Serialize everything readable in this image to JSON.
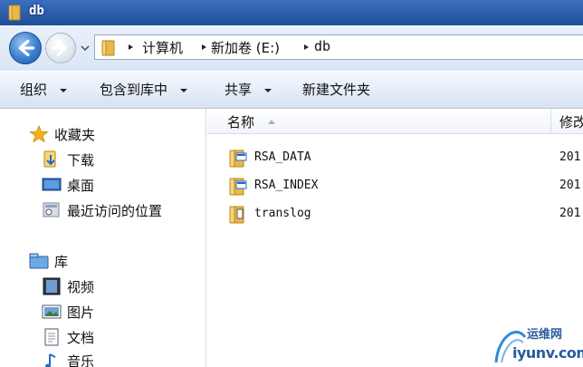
{
  "window": {
    "title": "db"
  },
  "address": {
    "crumbs": [
      "计算机",
      "新加卷 (E:)",
      "db"
    ]
  },
  "toolbar": {
    "organize": "组织",
    "include_in_library": "包含到库中",
    "share": "共享",
    "new_folder": "新建文件夹"
  },
  "sidebar": {
    "favorites": {
      "label": "收藏夹",
      "items": [
        "下载",
        "桌面",
        "最近访问的位置"
      ]
    },
    "libraries": {
      "label": "库",
      "items": [
        "视频",
        "图片",
        "文档",
        "音乐"
      ]
    }
  },
  "columns": {
    "name": "名称",
    "date_modified": "修改"
  },
  "files": [
    {
      "name": "RSA_DATA",
      "date": "201",
      "icon": "folder-config-icon"
    },
    {
      "name": "RSA_INDEX",
      "date": "201",
      "icon": "folder-config-icon"
    },
    {
      "name": "translog",
      "date": "201",
      "icon": "folder-doc-icon"
    }
  ],
  "watermark": {
    "top": "运维网",
    "bottom": "iyunv.com"
  },
  "colors": {
    "titlebar": "#2e5fae",
    "folder": "#e8b84a"
  }
}
